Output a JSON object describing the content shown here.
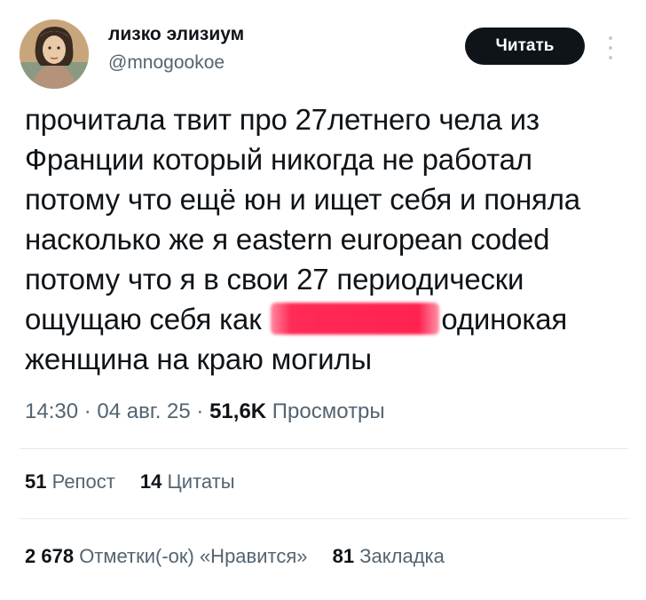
{
  "author": {
    "name": "лизко элизиум",
    "handle": "@mnogookoe"
  },
  "follow_button": {
    "label": "Читать"
  },
  "tweet": {
    "lines": [
      "прочитала твит про 27летнего чела из",
      "Франции который никогда не работал",
      "потому что ещё юн и ищет себя и поняла",
      "насколько же я eastern european coded",
      "потому что я в свои 27 периодически"
    ],
    "line6_before": "ощущаю себя как",
    "line6_after": "одинокая",
    "line7": "женщина на краю могилы"
  },
  "meta": {
    "time": "14:30",
    "date": "04 авг. 25",
    "views_count": "51,6K",
    "views_label": "Просмотры",
    "separator": "·"
  },
  "stats": {
    "reposts_count": "51",
    "reposts_label": "Репост",
    "quotes_count": "14",
    "quotes_label": "Цитаты",
    "likes_count": "2 678",
    "likes_label": "Отметки(-ок) «Нравится»",
    "bookmarks_count": "81",
    "bookmarks_label": "Закладка"
  },
  "colors": {
    "text": "#0f1419",
    "secondary": "#536471",
    "button_bg": "#0f1419",
    "redaction": "#ff2350",
    "divider": "#e6e9ec"
  }
}
